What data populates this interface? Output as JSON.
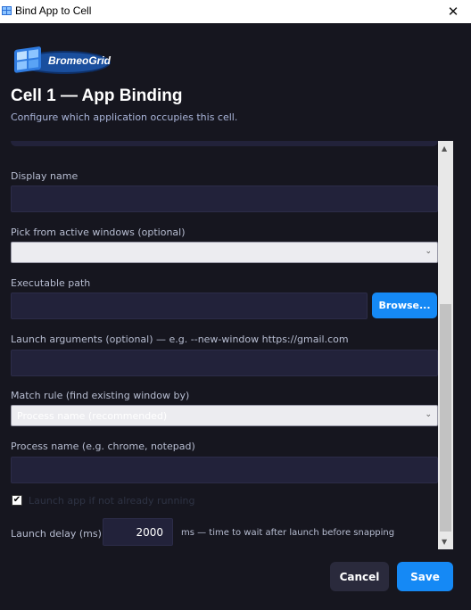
{
  "window": {
    "title": "Bind App to Cell",
    "close_glyph": "✕",
    "app_icon": "app-grid-icon"
  },
  "brand": {
    "logo_text": "BromeoGrid"
  },
  "header": {
    "title": "Cell 1 — App Binding",
    "subtitle": "Configure which application occupies this cell."
  },
  "form": {
    "display_name": {
      "label": "Display name",
      "value": ""
    },
    "active_windows": {
      "label": "Pick from active windows (optional)",
      "selected": ""
    },
    "executable": {
      "label": "Executable path",
      "value": "",
      "browse_label": "Browse..."
    },
    "launch_args": {
      "label": "Launch arguments (optional)",
      "hint": "—  e.g. --new-window https://gmail.com",
      "value": ""
    },
    "match_rule": {
      "label": "Match rule (find existing window by)",
      "selected": "Process name (recommended)"
    },
    "process_name": {
      "label": "Process name (e.g. chrome, notepad)",
      "value": ""
    },
    "launch_if_not_running": {
      "label": "Launch app if not already running",
      "checked": true,
      "check_glyph": "✔"
    },
    "launch_delay": {
      "label": "Launch delay (ms)",
      "value": "2000",
      "unit_text": "ms  — time to wait after launch before snapping"
    }
  },
  "footer": {
    "cancel_label": "Cancel",
    "save_label": "Save"
  },
  "colors": {
    "accent": "#1589f5",
    "background": "#16161f",
    "field": "#22223a"
  }
}
